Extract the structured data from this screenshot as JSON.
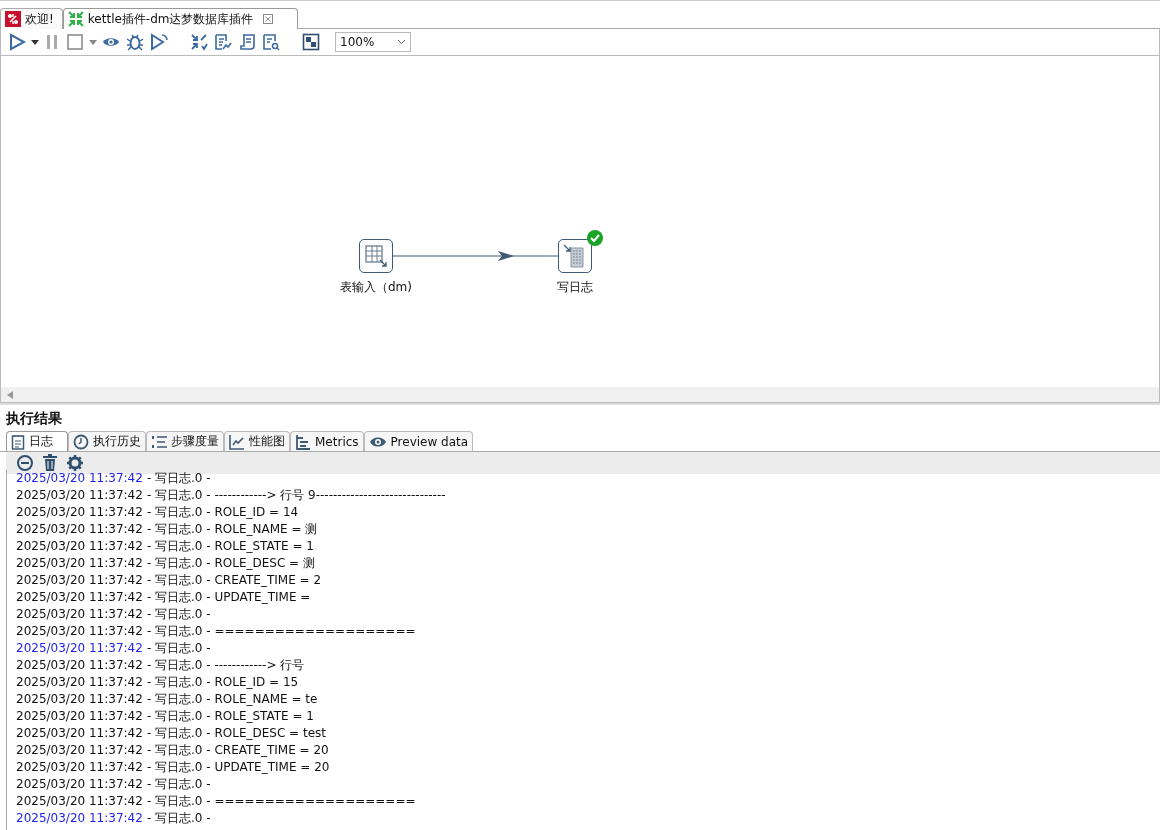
{
  "editor_tabs": [
    {
      "label": "欢迎!",
      "kind": "welcome",
      "selected": false
    },
    {
      "label": "kettle插件-dm达梦数据库插件",
      "kind": "transformation",
      "selected": true
    }
  ],
  "toolbar": {
    "zoom": "100%"
  },
  "canvas": {
    "nodes": [
      {
        "label": "表输入（dm)",
        "kind": "table-input",
        "finished": false
      },
      {
        "label": "写日志",
        "kind": "write-log",
        "finished": true
      }
    ]
  },
  "results": {
    "title": "执行结果",
    "tabs": [
      {
        "label": "日志",
        "kind": "log",
        "selected": true
      },
      {
        "label": "执行历史",
        "kind": "history",
        "selected": false
      },
      {
        "label": "步骤度量",
        "kind": "metrics-list",
        "selected": false
      },
      {
        "label": "性能图",
        "kind": "chart",
        "selected": false
      },
      {
        "label": "Metrics",
        "kind": "tree",
        "selected": false
      },
      {
        "label": "Preview data",
        "kind": "eye",
        "selected": false
      }
    ],
    "log": [
      {
        "time": "2025/03/20 11:37:42",
        "text": "- 写日志.0 -",
        "highlight": true
      },
      {
        "time": "2025/03/20 11:37:42",
        "text": "- 写日志.0 - ------------> 行号 9------------------------------",
        "highlight": false
      },
      {
        "time": "2025/03/20 11:37:42",
        "text": "- 写日志.0 - ROLE_ID = 14",
        "highlight": false
      },
      {
        "time": "2025/03/20 11:37:42",
        "text": "- 写日志.0 - ROLE_NAME = 测",
        "highlight": false
      },
      {
        "time": "2025/03/20 11:37:42",
        "text": "- 写日志.0 - ROLE_STATE = 1",
        "highlight": false
      },
      {
        "time": "2025/03/20 11:37:42",
        "text": "- 写日志.0 - ROLE_DESC = 测",
        "highlight": false
      },
      {
        "time": "2025/03/20 11:37:42",
        "text": "- 写日志.0 - CREATE_TIME = 2",
        "highlight": false
      },
      {
        "time": "2025/03/20 11:37:42",
        "text": "- 写日志.0 - UPDATE_TIME =",
        "highlight": false
      },
      {
        "time": "2025/03/20 11:37:42",
        "text": "- 写日志.0 -",
        "highlight": false
      },
      {
        "time": "2025/03/20 11:37:42",
        "text": "- 写日志.0 - ====================",
        "highlight": false
      },
      {
        "time": "2025/03/20 11:37:42",
        "text": "- 写日志.0 -",
        "highlight": true
      },
      {
        "time": "2025/03/20 11:37:42",
        "text": "- 写日志.0 - ------------> 行号",
        "highlight": false
      },
      {
        "time": "2025/03/20 11:37:42",
        "text": "- 写日志.0 - ROLE_ID = 15",
        "highlight": false
      },
      {
        "time": "2025/03/20 11:37:42",
        "text": "- 写日志.0 - ROLE_NAME = te",
        "highlight": false
      },
      {
        "time": "2025/03/20 11:37:42",
        "text": "- 写日志.0 - ROLE_STATE = 1",
        "highlight": false
      },
      {
        "time": "2025/03/20 11:37:42",
        "text": "- 写日志.0 - ROLE_DESC = test",
        "highlight": false
      },
      {
        "time": "2025/03/20 11:37:42",
        "text": "- 写日志.0 - CREATE_TIME = 20",
        "highlight": false
      },
      {
        "time": "2025/03/20 11:37:42",
        "text": "- 写日志.0 - UPDATE_TIME = 20",
        "highlight": false
      },
      {
        "time": "2025/03/20 11:37:42",
        "text": "- 写日志.0 -",
        "highlight": false
      },
      {
        "time": "2025/03/20 11:37:42",
        "text": "- 写日志.0 - ====================",
        "highlight": false
      },
      {
        "time": "2025/03/20 11:37:42",
        "text": "- 写日志.0 -",
        "highlight": true
      }
    ]
  }
}
